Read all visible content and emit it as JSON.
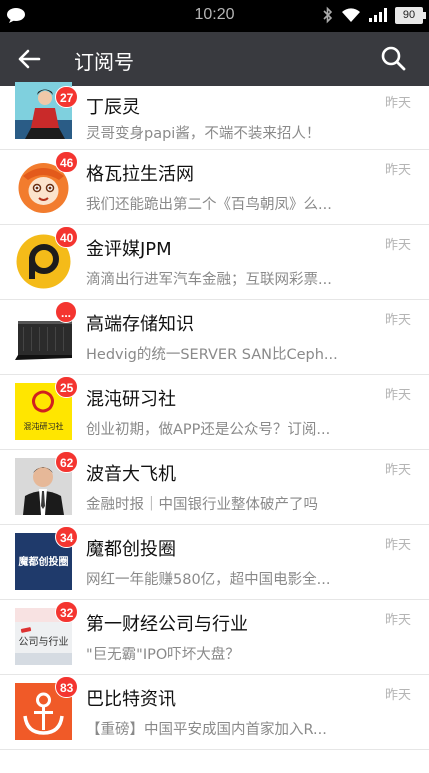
{
  "status_bar": {
    "time": "10:20",
    "battery": "90",
    "icons": [
      "chat-bubble-icon",
      "bluetooth-icon",
      "wifi-icon",
      "signal-icon",
      "battery-icon"
    ]
  },
  "app_bar": {
    "title": "订阅号",
    "back_icon": "back-arrow-icon",
    "search_icon": "search-icon",
    "background": "#393a3f"
  },
  "colors": {
    "badge": "#f43530",
    "time_text": "#b5b5b5",
    "preview_text": "#8a8a8a"
  },
  "items": [
    {
      "name": "丁辰灵",
      "preview": "灵哥变身papi酱，不端不装来招人！",
      "time": "昨天",
      "badge": "27"
    },
    {
      "name": "格瓦拉生活网",
      "preview": "我们还能跪出第二个《百鸟朝凤》么...",
      "time": "昨天",
      "badge": "46"
    },
    {
      "name": "金评媒JPM",
      "preview": "滴滴出行进军汽车金融；互联网彩票...",
      "time": "昨天",
      "badge": "40"
    },
    {
      "name": "高端存储知识",
      "preview": "Hedvig的统一SERVER SAN比Ceph...",
      "time": "昨天",
      "badge": "..."
    },
    {
      "name": "混沌研习社",
      "preview": "创业初期，做APP还是公众号？订阅...",
      "time": "昨天",
      "badge": "25",
      "avatar_text": "混沌研习社"
    },
    {
      "name": "波音大飞机",
      "preview": "金融时报｜中国银行业整体破产了吗",
      "time": "昨天",
      "badge": "62"
    },
    {
      "name": "魔都创投圈",
      "preview": "网红一年能赚580亿，超中国电影全...",
      "time": "昨天",
      "badge": "34",
      "avatar_text": "魔都创投圈"
    },
    {
      "name": "第一财经公司与行业",
      "preview": "\"巨无霸\"IPO吓坏大盘？",
      "time": "昨天",
      "badge": "32",
      "avatar_text": "公司与行业"
    },
    {
      "name": "巴比特资讯",
      "preview": "【重磅】中国平安成国内首家加入R...",
      "time": "昨天",
      "badge": "83"
    }
  ]
}
